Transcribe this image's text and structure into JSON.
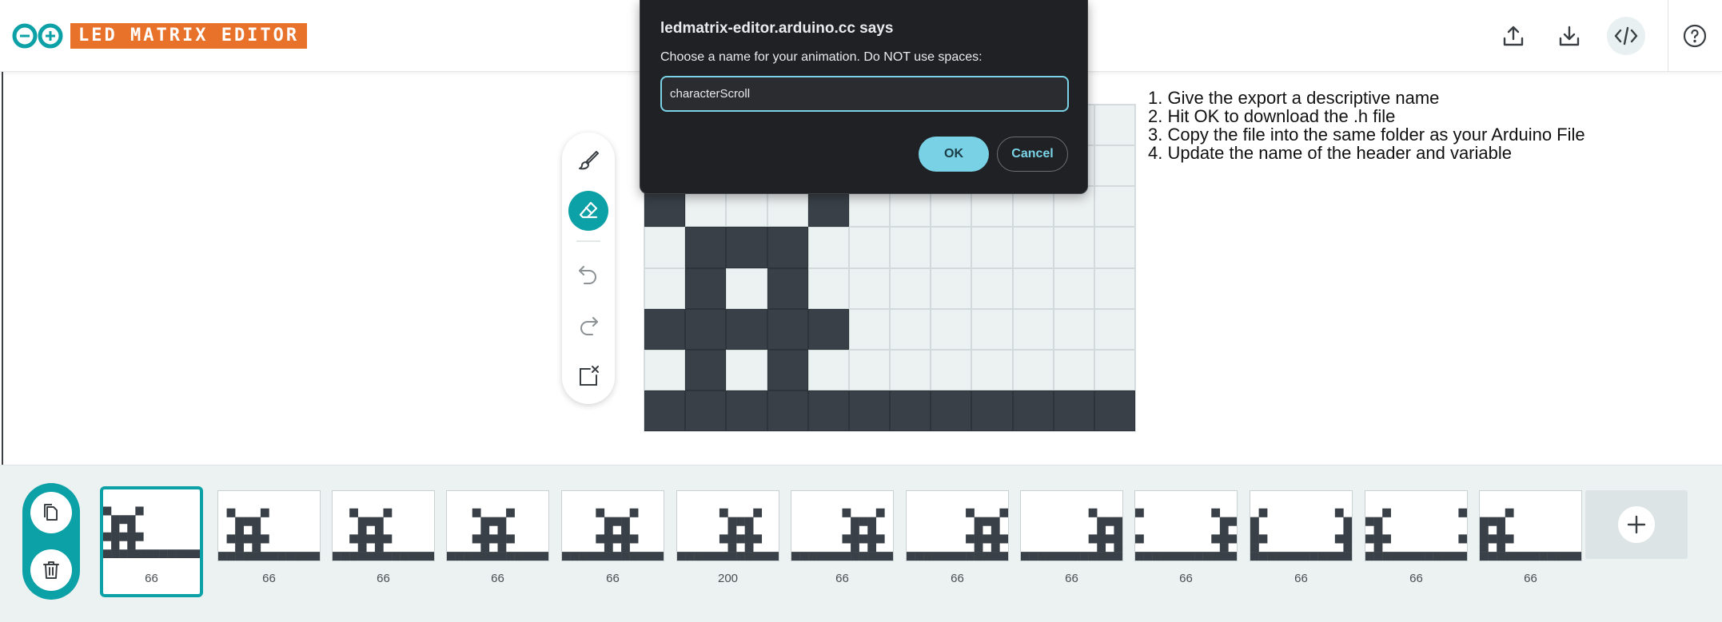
{
  "header": {
    "title": "LED MATRIX EDITOR",
    "icons": [
      "arduino-logo",
      "upload-icon",
      "download-icon",
      "code-icon",
      "help-icon"
    ]
  },
  "dialog": {
    "title": "ledmatrix-editor.arduino.cc says",
    "message": "Choose a name for your animation. Do NOT use spaces:",
    "input_value": "characterScroll",
    "ok_label": "OK",
    "cancel_label": "Cancel"
  },
  "instructions": [
    "1. Give the export a descriptive name",
    "2. Hit OK to download the .h file",
    "3. Copy the file into the same folder as your Arduino File",
    "4. Update the name of the header and variable"
  ],
  "toolbar": {
    "tools": [
      "brush",
      "eraser",
      "undo",
      "redo",
      "clear"
    ],
    "active_tool": "eraser"
  },
  "colors": {
    "accent": "#0ca1a6",
    "led_on": "#394047",
    "led_off": "#ecf1f1",
    "title_bg": "#e8722a",
    "dialog_bg": "#202124",
    "dialog_accent": "#78d1e5"
  },
  "matrix": {
    "rows": [
      "000000000000",
      "000000000000",
      "100010000000",
      "011100000000",
      "010100000000",
      "111110000000",
      "010100000000",
      "111111111111"
    ]
  },
  "frames": [
    {
      "duration": "66",
      "selected": true,
      "offset": 0
    },
    {
      "duration": "66",
      "selected": false,
      "offset": 1
    },
    {
      "duration": "66",
      "selected": false,
      "offset": 2
    },
    {
      "duration": "66",
      "selected": false,
      "offset": 3
    },
    {
      "duration": "66",
      "selected": false,
      "offset": 4
    },
    {
      "duration": "200",
      "selected": false,
      "offset": 5
    },
    {
      "duration": "66",
      "selected": false,
      "offset": 6
    },
    {
      "duration": "66",
      "selected": false,
      "offset": 7
    },
    {
      "duration": "66",
      "selected": false,
      "offset": 8
    },
    {
      "duration": "66",
      "selected": false,
      "offset": 9
    },
    {
      "duration": "66",
      "selected": false,
      "offset": 10
    },
    {
      "duration": "66",
      "selected": false,
      "offset": 11
    },
    {
      "duration": "66",
      "selected": false,
      "offset": 12
    }
  ]
}
